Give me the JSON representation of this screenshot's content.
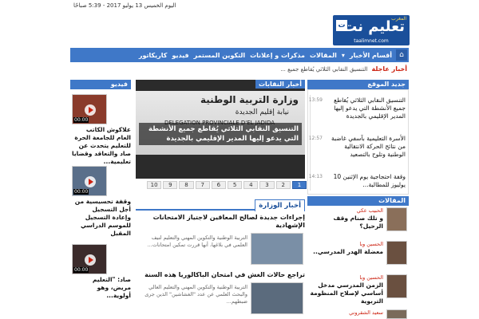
{
  "topbar": {
    "date": "اليوم الخميس 13 يوليو 2017 - 5:39 صباحًا"
  },
  "logo": {
    "main": "تعليم نت",
    "badge": "المغرب",
    "domain": "taalimnet.com",
    "mark": "ت"
  },
  "nav": {
    "items": [
      "أقسام الأخبار",
      "المقالات",
      "مذكرات و إعلانات",
      "التكوين المستمر",
      "فيديو",
      "كاريكاتور"
    ]
  },
  "ticker": {
    "label": "أخبار عاجلة",
    "text": "التنسيق النقابي الثلاثي يُقاطع جميع ..."
  },
  "video": {
    "header": "فيديو",
    "items": [
      {
        "time": "00:00",
        "title": "علاكوش الكاتب العام للجامعة الحرة للتعليم يتحدث عن صاد والتعاقد وقضايا تعليمية..."
      },
      {
        "time": "00:00",
        "title": "وقفة تحسيسية من أجل التسجيل وإعادة التسجيل للموسم الدراسي المقبل"
      },
      {
        "time": "00:00",
        "title": "صاد: \"التعليم مريض، وهو أولوية..."
      }
    ]
  },
  "slider": {
    "tag": "أخبار النقابات",
    "sign_line1": "وزارة التربية الوطنية",
    "sign_line2": "نيابة إقليم الجديدة",
    "sign_line3": "DELEGATION PROVINCIALE D'EL JADIDA",
    "caption": "التنسيق النقابي الثلاثي يُقاطع جميع الأنشطة التي يدعو إليها المدير الإقليمي بالجديدة",
    "pages": [
      "10",
      "9",
      "8",
      "7",
      "6",
      "5",
      "4",
      "3",
      "2",
      "1"
    ],
    "active_page": "1"
  },
  "ministry": {
    "header": "أخبار الوزارة",
    "articles": [
      {
        "title": "إجراءات جديدة لصالح المعاقين لاجتياز الامتحانات الإشهادية",
        "excerpt": "التربية الوطنية والتكوين المهني والتعليم لنيف العلمي في بلاغها، أنها قررت تمكين امتحانات..."
      },
      {
        "title": "تراجع حالات الغش في امتحان الباكالوريا هذه السنة",
        "excerpt": "التربية الوطنية والتكوين المهني والتعليم العالي والبحث العلمي عن عدد \"الغشاشين\" الذين جرى ضبطهم..."
      }
    ]
  },
  "latest": {
    "header": "جديد الموقع",
    "items": [
      {
        "time": "13:59",
        "text": "التنسيق النقابي الثلاثي يُقاطع جميع الأنشطة التي يدعو إليها المدير الإقليمي بالجديدة"
      },
      {
        "time": "12:57",
        "text": "الأسرة التعليمية بآسفي غاضبة من نتائج الحركة الانتقالية الوطنية وتلوح بالتصعيد"
      },
      {
        "time": "14:13",
        "text": "وقفة احتجاجية يوم الإثنين 10 يوليوز للمطالبة..."
      }
    ]
  },
  "articles": {
    "header": "المقالات",
    "items": [
      {
        "author": "الحبيب عكي",
        "title": "و تلك صنام وقف الرحيل؟"
      },
      {
        "author": "الحسين وبا",
        "title": "معضلة الهدر المدرسي.."
      },
      {
        "author": "الحسين وبا",
        "title": "الزمن المدرسي مدخل أساسي لإصلاح المنظومة التربوية"
      },
      {
        "author": "سعيد الشقروني",
        "title": ""
      }
    ]
  }
}
